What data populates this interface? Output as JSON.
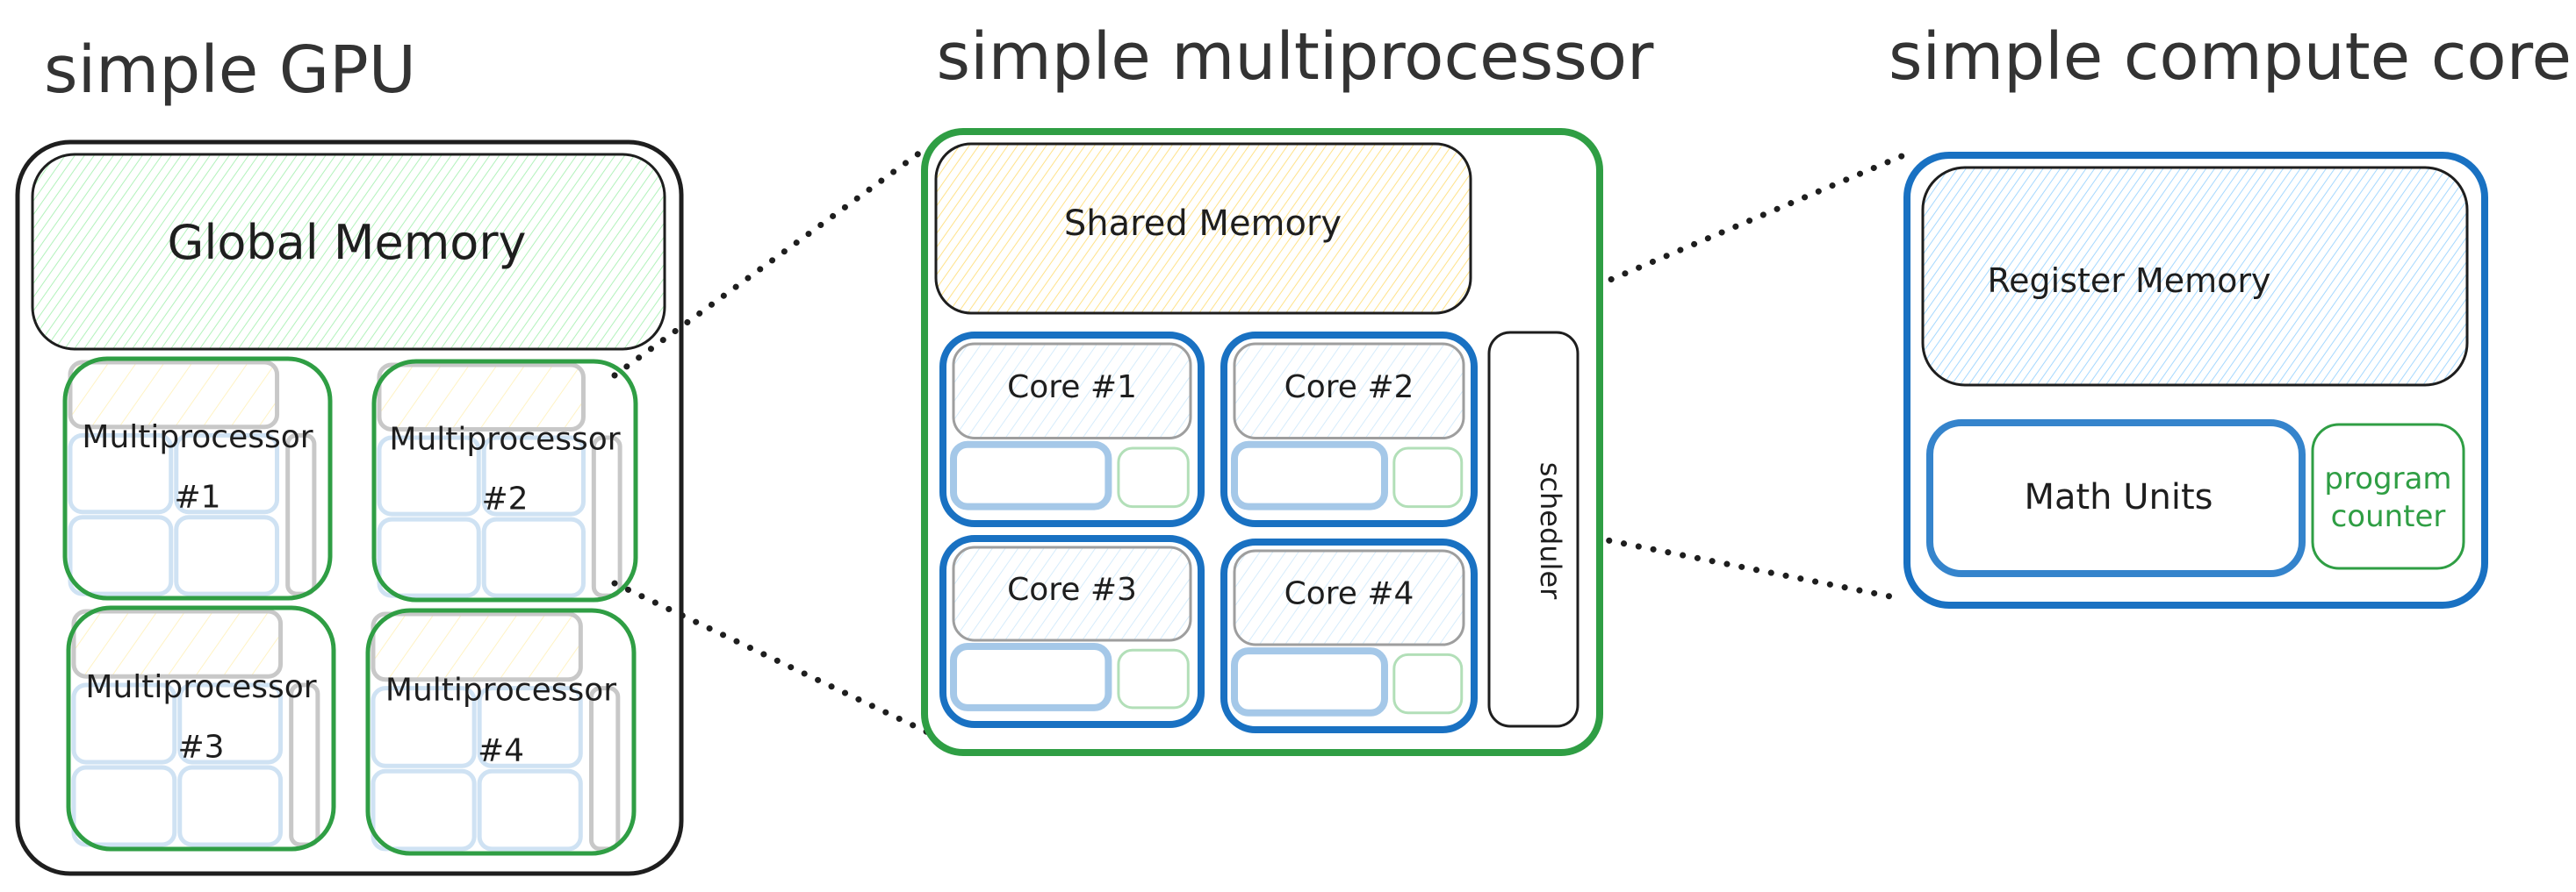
{
  "colors": {
    "ink": "#1e1e1e",
    "title": "#333333",
    "green": "#2f9e44",
    "blue": "#1971c2",
    "light_blue": "#a5c8e8",
    "pale_blue_stroke": "#cfe2f3",
    "light_green": "#b2dfb8",
    "gray": "#c8c8c8",
    "global_mem_fill": "#b2f2bb",
    "shared_mem_fill": "#ffec99",
    "register_mem_fill": "#a5d8ff"
  },
  "gpu": {
    "title": "simple GPU",
    "global_memory_label": "Global Memory",
    "multiprocessors": [
      {
        "label_line1": "Multiprocessor",
        "label_line2": "#1"
      },
      {
        "label_line1": "Multiprocessor",
        "label_line2": "#2"
      },
      {
        "label_line1": "Multiprocessor",
        "label_line2": "#3"
      },
      {
        "label_line1": "Multiprocessor",
        "label_line2": "#4"
      }
    ]
  },
  "multiprocessor": {
    "title": "simple multiprocessor",
    "shared_memory_label": "Shared Memory",
    "scheduler_label": "scheduler",
    "cores": [
      {
        "label": "Core #1"
      },
      {
        "label": "Core #2"
      },
      {
        "label": "Core #3"
      },
      {
        "label": "Core #4"
      }
    ]
  },
  "compute_core": {
    "title": "simple compute core",
    "register_memory_label": "Register Memory",
    "math_units_label": "Math Units",
    "program_counter_line1": "program",
    "program_counter_line2": "counter"
  }
}
